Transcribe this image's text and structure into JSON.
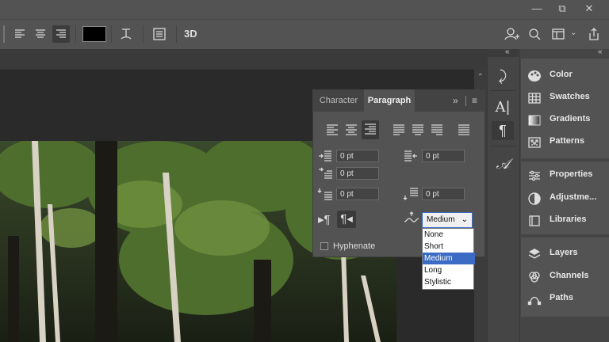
{
  "window": {
    "minimize": "—",
    "restore": "⧉",
    "close": "✕"
  },
  "options_bar": {
    "label_3d": "3D"
  },
  "paragraph_panel": {
    "tabs": [
      {
        "label": "Character"
      },
      {
        "label": "Paragraph"
      }
    ],
    "collapse_glyph": "»",
    "fields": {
      "indent_left": "0 pt",
      "indent_right": "0 pt",
      "indent_first": "0 pt",
      "space_before": "0 pt",
      "space_after": "0 pt"
    },
    "hyphenate_label": "Hyphenate",
    "hyphenate_checked": false,
    "justification_dropdown": {
      "selected": "Medium",
      "options": [
        "None",
        "Short",
        "Medium",
        "Long",
        "Stylistic"
      ],
      "highlighted": "Medium"
    }
  },
  "right_panel": {
    "group1": [
      {
        "label": "Color",
        "icon": "color-palette-icon"
      },
      {
        "label": "Swatches",
        "icon": "swatches-grid-icon"
      },
      {
        "label": "Gradients",
        "icon": "gradient-icon"
      },
      {
        "label": "Patterns",
        "icon": "patterns-icon"
      }
    ],
    "group2": [
      {
        "label": "Properties",
        "icon": "properties-sliders-icon"
      },
      {
        "label": "Adjustme...",
        "icon": "adjustments-icon"
      },
      {
        "label": "Libraries",
        "icon": "libraries-icon"
      }
    ],
    "group3": [
      {
        "label": "Layers",
        "icon": "layers-icon"
      },
      {
        "label": "Channels",
        "icon": "channels-icon"
      },
      {
        "label": "Paths",
        "icon": "paths-icon"
      }
    ]
  },
  "colors": {
    "accent_highlight": "#3b6bc4",
    "panel_bg": "#535353",
    "text_color_swatch": "#000000"
  }
}
